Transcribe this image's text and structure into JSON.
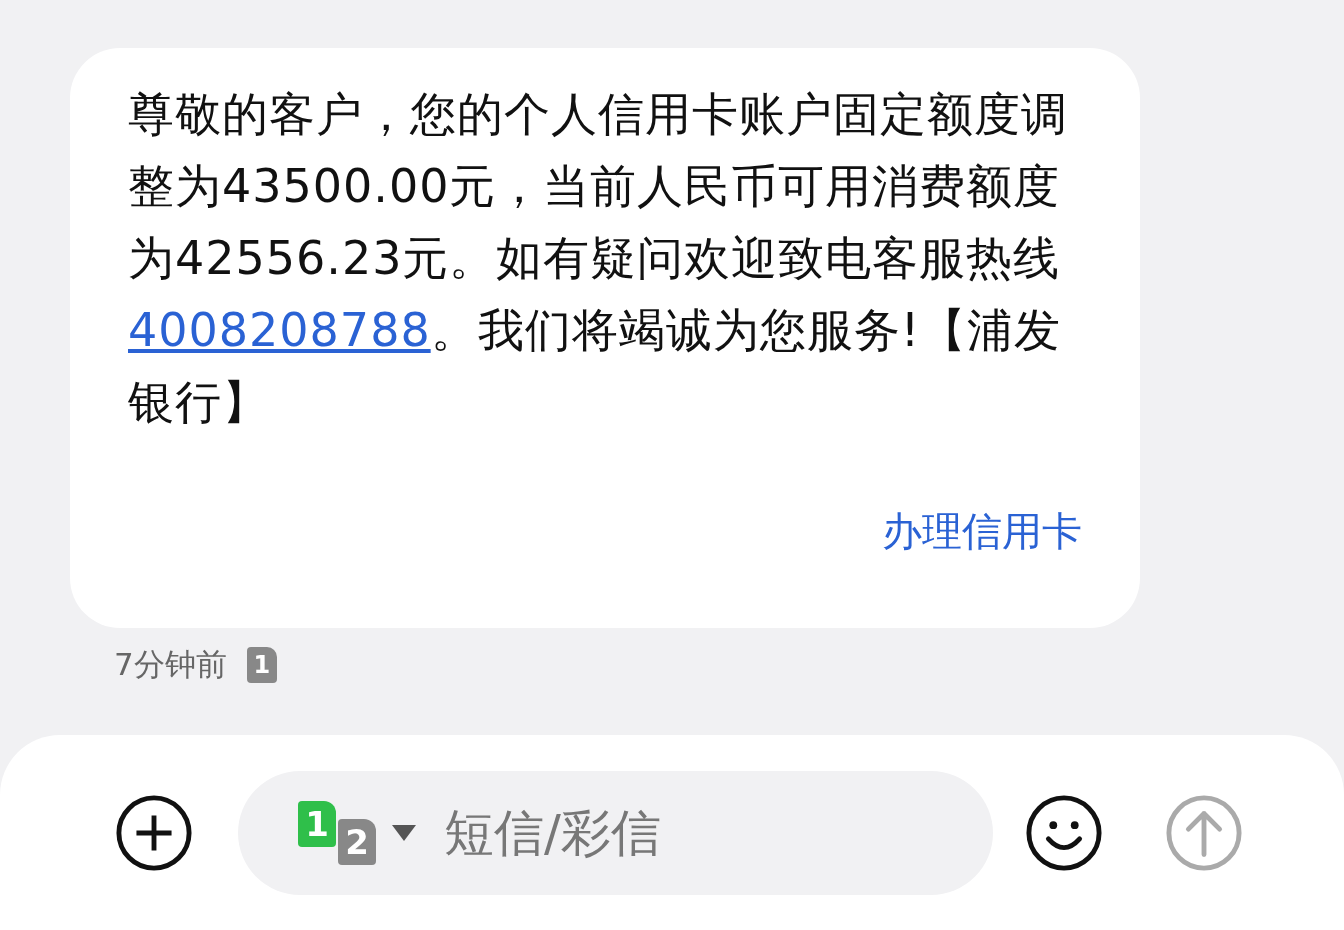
{
  "message": {
    "text_before": "尊敬的客户，您的个人信用卡账户固定额度调整为43500.00元，当前人民币可用消费额度为42556.23元。如有疑问欢迎致电客服热线",
    "link": "4008208788",
    "text_after": "。我们将竭诚为您服务!【浦发银行】",
    "action": "办理信用卡"
  },
  "timestamp": "7分钟前",
  "sim_badge": "1",
  "composer": {
    "sims": [
      {
        "label": "1",
        "selected": true
      },
      {
        "label": "2",
        "selected": false
      }
    ],
    "placeholder": "短信/彩信"
  }
}
